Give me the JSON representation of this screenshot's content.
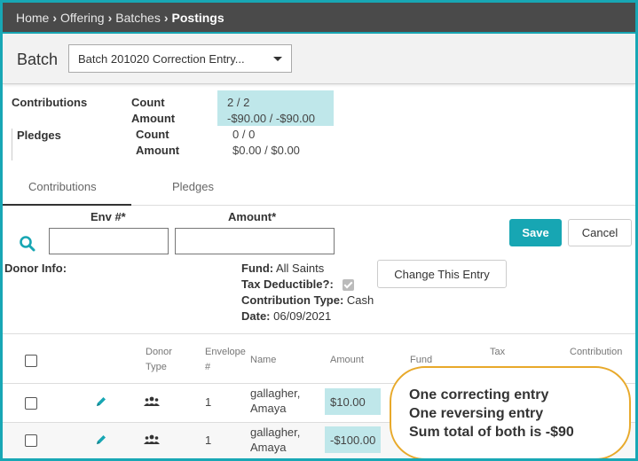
{
  "breadcrumb": {
    "items": [
      "Home",
      "Offering",
      "Batches"
    ],
    "current": "Postings"
  },
  "batch": {
    "label": "Batch",
    "selected": "Batch 201020 Correction Entry..."
  },
  "summary": {
    "contributions_label": "Contributions",
    "pledges_label": "Pledges",
    "count_label": "Count",
    "amount_label": "Amount",
    "contributions_count": "2 / 2",
    "contributions_amount": "-$90.00 / -$90.00",
    "pledges_count": "0 / 0",
    "pledges_amount": "$0.00 / $0.00"
  },
  "tabs": [
    {
      "label": "Contributions",
      "active": true
    },
    {
      "label": "Pledges",
      "active": false
    }
  ],
  "form": {
    "env_label": "Env #*",
    "amount_label": "Amount*",
    "env_value": "",
    "amount_value": "",
    "save_label": "Save",
    "cancel_label": "Cancel",
    "change_label": "Change This Entry",
    "donor_info_label": "Donor Info:",
    "fund_label": "Fund:",
    "fund_value": "All Saints",
    "tax_label": "Tax Deductible?:",
    "tax_checked": true,
    "type_label": "Contribution Type:",
    "type_value": "Cash",
    "date_label": "Date:",
    "date_value": "06/09/2021"
  },
  "table": {
    "headers": {
      "donor_type": [
        "Donor",
        "Type"
      ],
      "envelope": [
        "Envelope",
        "#"
      ],
      "name": "Name",
      "amount": "Amount",
      "fund": "Fund",
      "tax": "Tax",
      "contribution": "Contribution"
    },
    "rows": [
      {
        "envelope": "1",
        "name": [
          "gallagher,",
          "Amaya"
        ],
        "amount": "$10.00"
      },
      {
        "envelope": "1",
        "name": [
          "gallagher,",
          "Amaya"
        ],
        "amount": "-$100.00"
      }
    ]
  },
  "callout": {
    "lines": [
      "One correcting entry",
      "One reversing entry",
      "Sum total of both is -$90"
    ]
  },
  "colors": {
    "accent": "#17a6b3",
    "highlight": "#bfe7ea",
    "callout_border": "#e8a92a",
    "header_bar": "#4a4a4a"
  },
  "icons": {
    "search": "search-icon",
    "edit": "pencil-icon",
    "donor": "users-icon"
  }
}
